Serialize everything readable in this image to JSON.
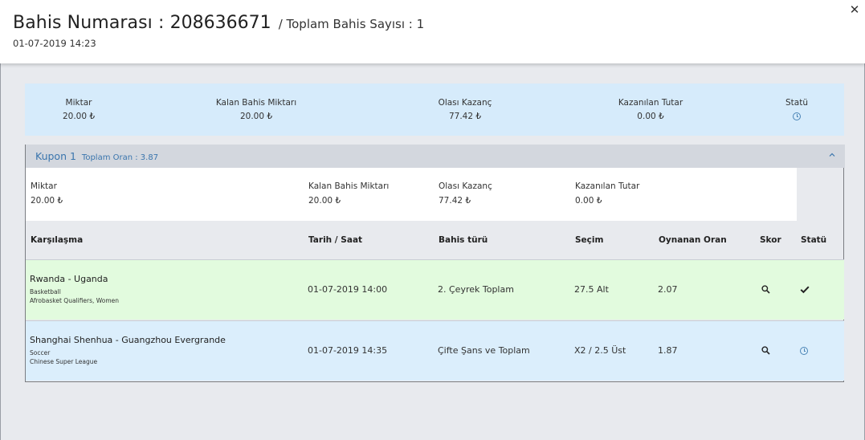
{
  "header": {
    "title": "Bahis Numarası : ",
    "bet_number": "208636671",
    "subtitle": "/ Toplam Bahis Sayısı : 1",
    "date": "01-07-2019 14:23",
    "close_icon": "close-icon"
  },
  "summary": {
    "amount_label": "Miktar",
    "amount_value": "20.00 ₺",
    "remaining_label": "Kalan Bahis Miktarı",
    "remaining_value": "20.00 ₺",
    "potential_label": "Olası Kazanç",
    "potential_value": "77.42 ₺",
    "won_label": "Kazanılan Tutar",
    "won_value": "0.00 ₺",
    "status_label": "Statü",
    "status_icon": "clock-icon"
  },
  "coupon": {
    "name": "Kupon 1",
    "total_odds": "Toplam Oran : 3.87",
    "amount_label": "Miktar",
    "amount_value": "20.00 ₺",
    "remaining_label": "Kalan Bahis Miktarı",
    "remaining_value": "20.00 ₺",
    "potential_label": "Olası Kazanç",
    "potential_value": "77.42 ₺",
    "won_label": "Kazanılan Tutar",
    "won_value": "0.00 ₺"
  },
  "columns": {
    "match": "Karşılaşma",
    "datetime": "Tarih / Saat",
    "bet_type": "Bahis türü",
    "selection": "Seçim",
    "odds": "Oynanan Oran",
    "score": "Skor",
    "status": "Statü"
  },
  "rows": [
    {
      "teams": "Rwanda - Uganda",
      "sport": "Basketball",
      "league": "Afrobasket Qualifiers, Women",
      "datetime": "01-07-2019 14:00",
      "bet_type": "2. Çeyrek Toplam",
      "selection": "27.5 Alt",
      "odds": "2.07",
      "status": "won",
      "status_color": "#e2fbde"
    },
    {
      "teams": "Shanghai Shenhua - Guangzhou Evergrande",
      "sport": "Soccer",
      "league": "Chinese Super League",
      "datetime": "01-07-2019 14:35",
      "bet_type": "Çifte Şans ve Toplam",
      "selection": "X2 / 2.5 Üst",
      "odds": "1.87",
      "status": "pending",
      "status_color": "#dbeefc"
    }
  ],
  "colors": {
    "accent": "#3a75ad",
    "summary_bg": "#d6ebfb",
    "won_bg": "#e2fbde",
    "pending_bg": "#dbeefc"
  }
}
